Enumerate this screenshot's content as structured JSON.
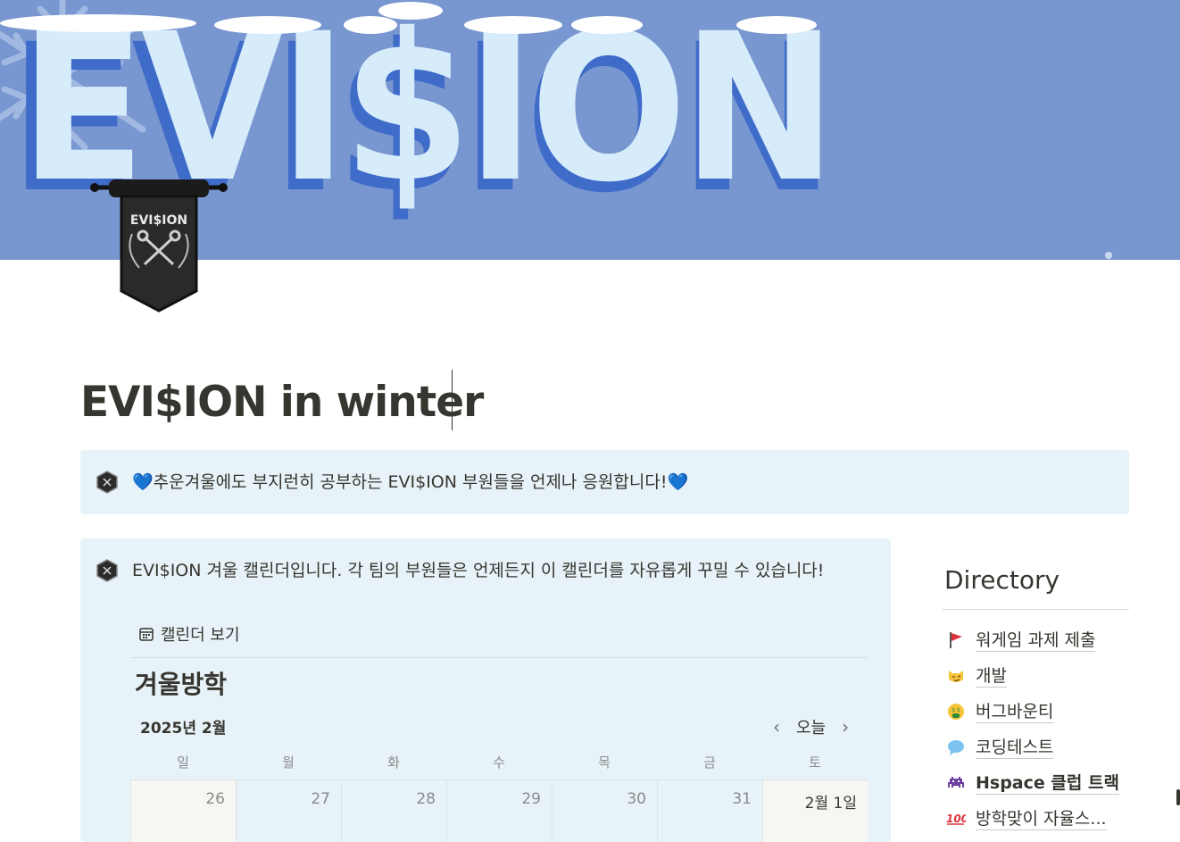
{
  "cover": {
    "brand": "EVI$ION",
    "colors": {
      "background": "#7896cf",
      "letters": "#d6ecfb",
      "shadow": "#3f6bc9",
      "snow": "#ffffff"
    }
  },
  "page_icon": {
    "brand": "EVI$ION",
    "icon": "crossed-keys-banner-icon"
  },
  "title": "EVI$ION in winter",
  "callout_top": {
    "text": "💙추운겨울에도 부지런히 공부하는 EVI$ION 부원들을 언제나 응원합니다!💙"
  },
  "callout_calendar": {
    "text": "EVI$ION 겨울 캘린더입니다. 각 팀의 부원들은 언제든지 이 캘린더를 자유롭게 꾸밀 수 있습니다!",
    "view_tab": "캘린더 보기",
    "database_title": "겨울방학",
    "month": "2025년 2월",
    "today_label": "오늘",
    "weekdays": [
      "일",
      "월",
      "화",
      "수",
      "목",
      "금",
      "토"
    ],
    "days": [
      "26",
      "27",
      "28",
      "29",
      "30",
      "31",
      "2월 1일"
    ]
  },
  "directory": {
    "title": "Directory",
    "items": [
      {
        "icon": "red-flag-icon",
        "label": "워게임 과제 제출",
        "bold": false
      },
      {
        "icon": "smirk-cat-icon",
        "label": "개발",
        "bold": false
      },
      {
        "icon": "money-mouth-icon",
        "label": "버그바운티",
        "bold": false
      },
      {
        "icon": "speech-bubble-icon",
        "label": "코딩테스트",
        "bold": false
      },
      {
        "icon": "space-invader-icon",
        "label": "Hspace 클럽 트랙",
        "bold": true
      },
      {
        "icon": "hundred-points-icon",
        "label": "방학맞이 자율스...",
        "bold": false
      }
    ]
  }
}
